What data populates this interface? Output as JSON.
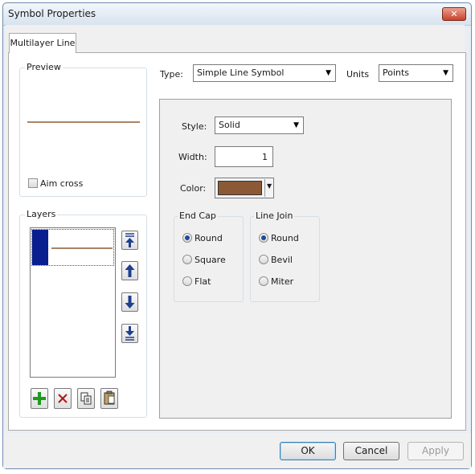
{
  "window": {
    "title": "Symbol Properties",
    "close_glyph": "✕"
  },
  "tabs": [
    {
      "label": "Multilayer Line",
      "active": true
    }
  ],
  "preview": {
    "group_label": "Preview",
    "line_color": "#8b5a35",
    "aim_cross": {
      "label": "Aim cross",
      "checked": false
    }
  },
  "layers": {
    "group_label": "Layers",
    "items": [
      {
        "line_color": "#8b5a35",
        "selected": true
      }
    ],
    "side_buttons": [
      {
        "name": "move-to-top-button",
        "icon": "arrow-to-top-icon",
        "glyph": "⭱"
      },
      {
        "name": "move-up-button",
        "icon": "arrow-up-icon",
        "glyph": "🡅"
      },
      {
        "name": "move-down-button",
        "icon": "arrow-down-icon",
        "glyph": "🡇"
      },
      {
        "name": "move-to-bottom-button",
        "icon": "arrow-to-bottom-icon",
        "glyph": "⭳"
      }
    ],
    "bottom_buttons": [
      {
        "name": "add-layer-button",
        "icon": "plus-icon",
        "glyph": "+",
        "color": "#1f9a1f"
      },
      {
        "name": "remove-layer-button",
        "icon": "delete-x-icon",
        "glyph": "✕",
        "color": "#b01818"
      },
      {
        "name": "copy-layer-button",
        "icon": "copy-icon",
        "glyph": "⧉",
        "color": "#333333"
      },
      {
        "name": "paste-layer-button",
        "icon": "paste-icon",
        "glyph": "📋",
        "color": "#333333"
      }
    ]
  },
  "type_row": {
    "label": "Type:",
    "value": "Simple Line Symbol"
  },
  "units_row": {
    "label": "Units",
    "value": "Points"
  },
  "properties": {
    "style": {
      "label": "Style:",
      "value": "Solid"
    },
    "width": {
      "label": "Width:",
      "value": "1"
    },
    "color": {
      "label": "Color:",
      "swatch": "#8b5a35"
    },
    "end_cap": {
      "label": "End Cap",
      "options": [
        {
          "label": "Round",
          "selected": true
        },
        {
          "label": "Square",
          "selected": false
        },
        {
          "label": "Flat",
          "selected": false
        }
      ]
    },
    "line_join": {
      "label": "Line Join",
      "options": [
        {
          "label": "Round",
          "selected": true
        },
        {
          "label": "Bevil",
          "selected": false
        },
        {
          "label": "Miter",
          "selected": false
        }
      ]
    }
  },
  "footer": {
    "ok_label": "OK",
    "cancel_label": "Cancel",
    "apply_label": "Apply",
    "apply_enabled": false
  },
  "colors": {
    "accent_selection": "#0a1f8f",
    "line_brown": "#8b5a35"
  }
}
